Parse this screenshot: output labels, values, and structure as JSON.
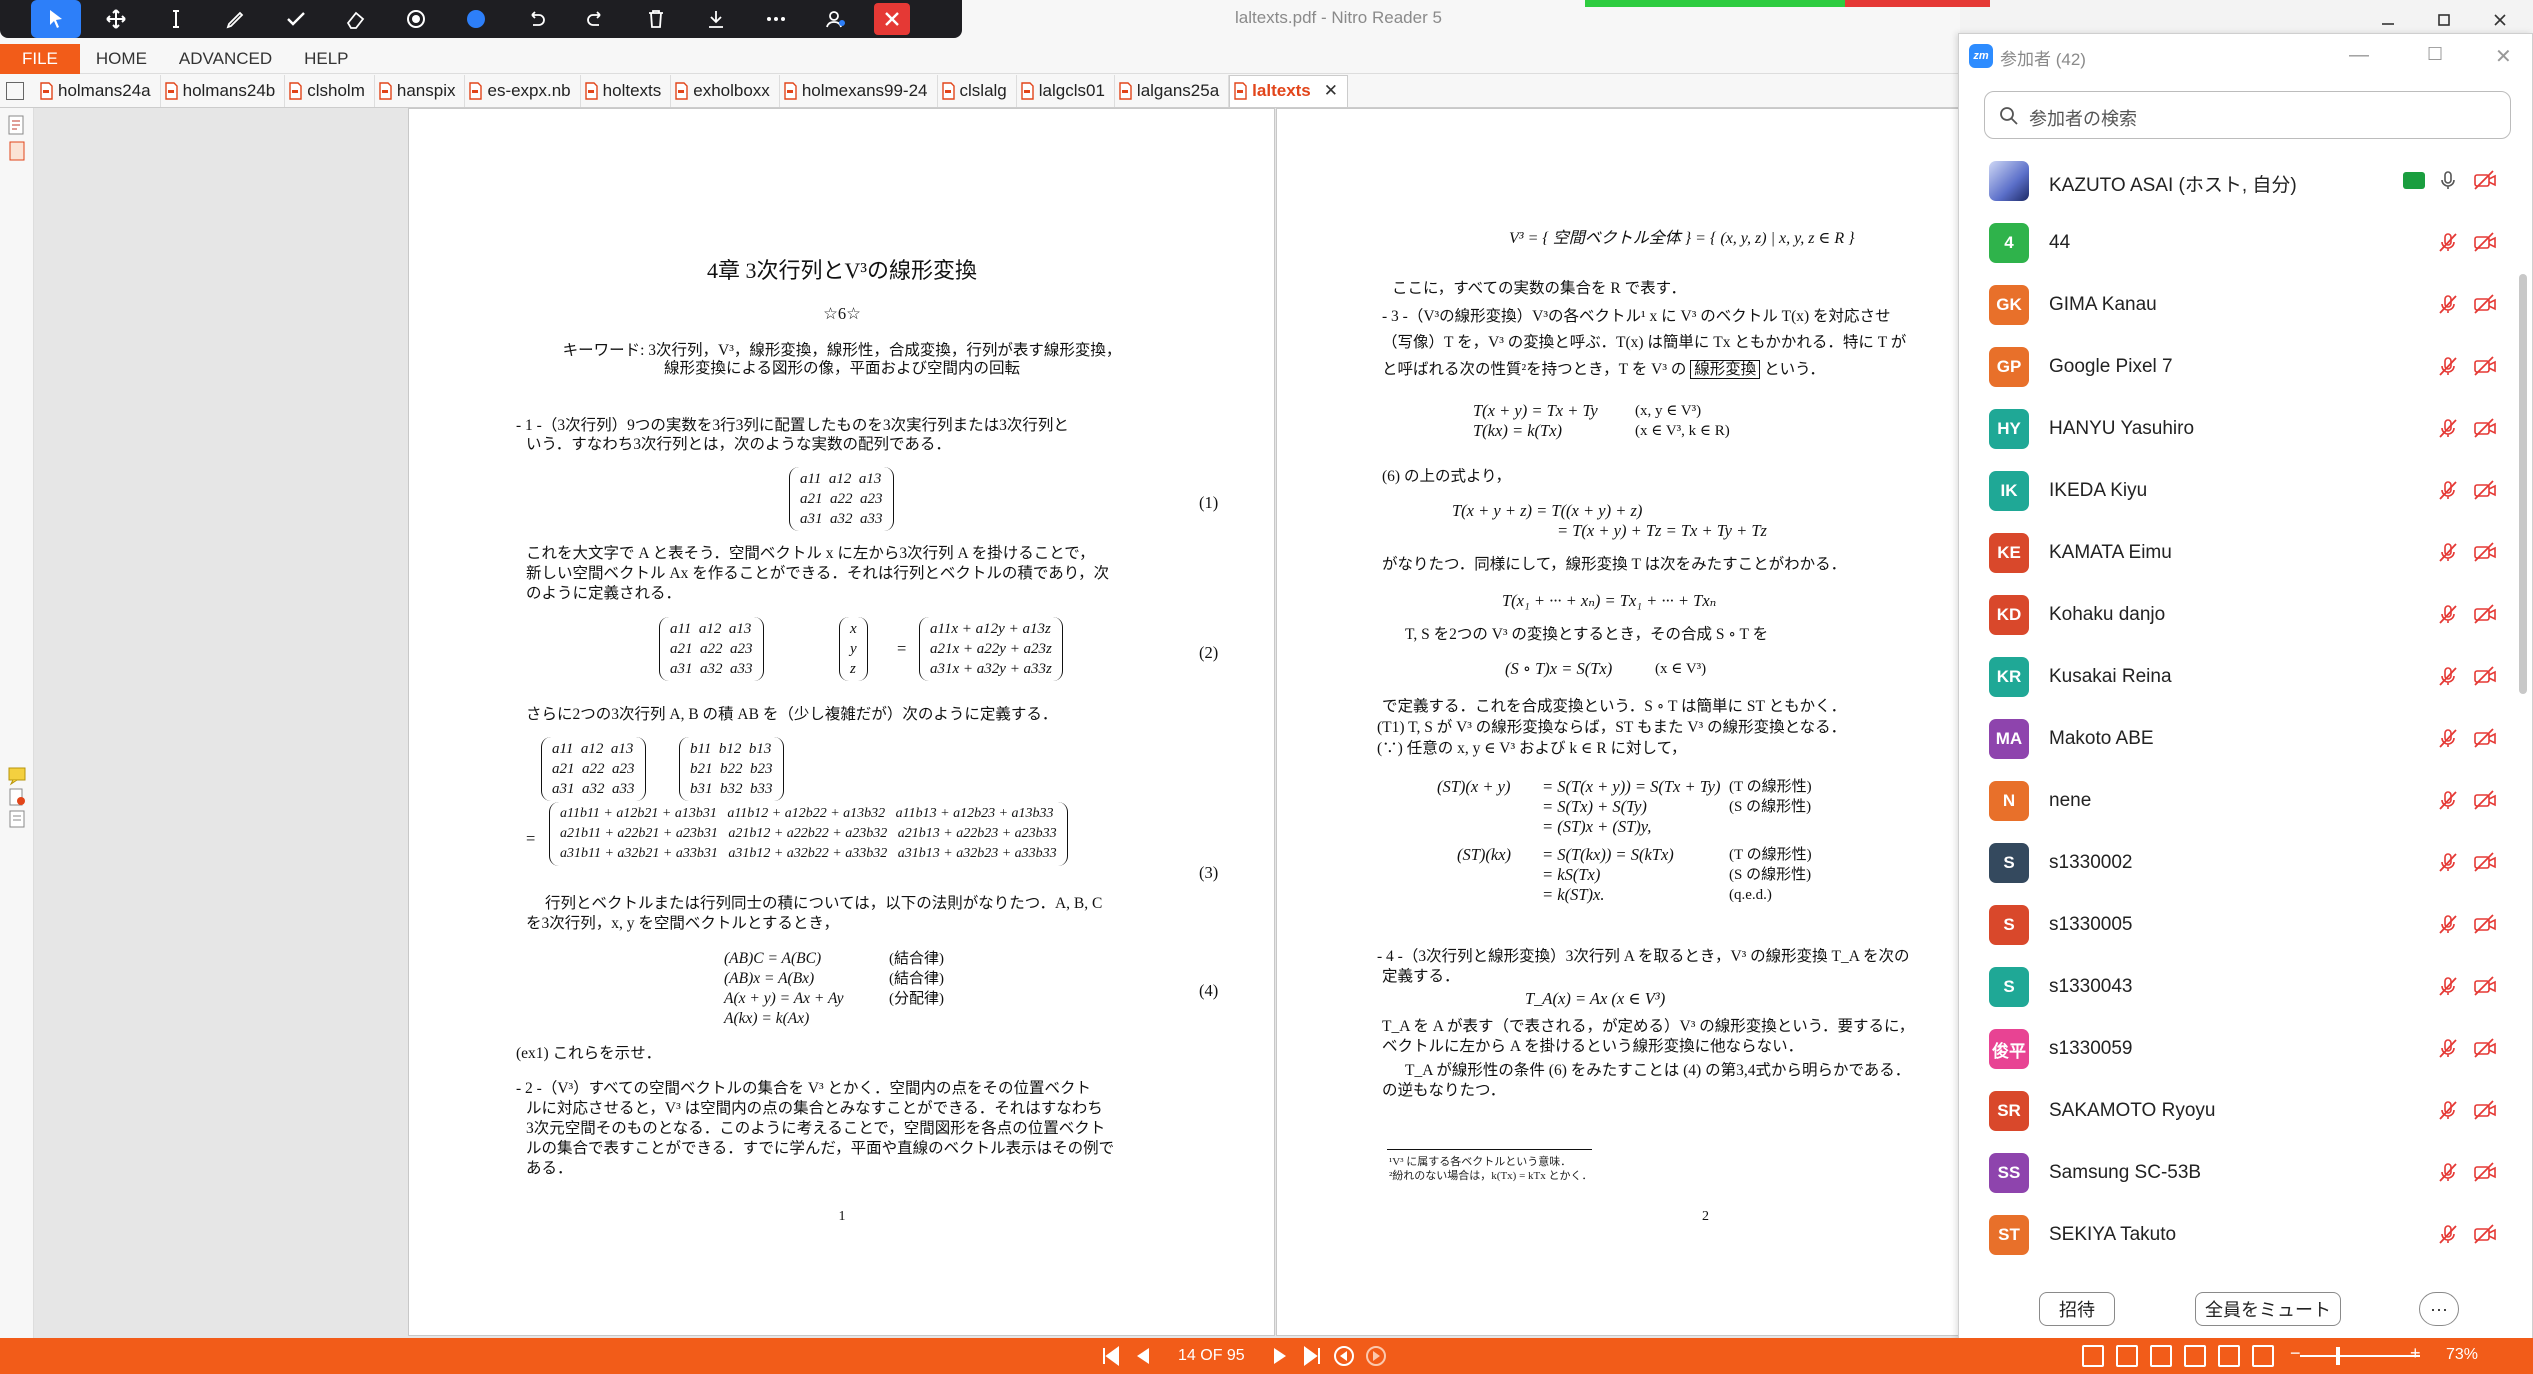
{
  "window": {
    "title": "laltexts.pdf - Nitro Reader 5"
  },
  "ribbon": {
    "tabs": [
      "FILE",
      "HOME",
      "ADVANCED",
      "HELP"
    ]
  },
  "doc_tabs": [
    {
      "label": "holmans24a",
      "active": false
    },
    {
      "label": "holmans24b",
      "active": false
    },
    {
      "label": "clsholm",
      "active": false
    },
    {
      "label": "hanspix",
      "active": false
    },
    {
      "label": "es-expx.nb",
      "active": false
    },
    {
      "label": "holtexts",
      "active": false
    },
    {
      "label": "exholboxx",
      "active": false
    },
    {
      "label": "holmexans99-24",
      "active": false
    },
    {
      "label": "clslalg",
      "active": false
    },
    {
      "label": "lalgcls01",
      "active": false
    },
    {
      "label": "lalgans25a",
      "active": false
    },
    {
      "label": "laltexts",
      "active": true
    }
  ],
  "page1": {
    "title": "4章 3次行列とV³の線形変換",
    "stars": "☆6☆",
    "keywords_1": "キーワード: 3次行列，V³，線形変換，線形性，合成変換，行列が表す線形変換，",
    "keywords_2": "線形変換による図形の像，平面および空間内の回転",
    "s1_a": "- 1 -（3次行列）9つの実数を3行3列に配置したものを3次実行列または3次行列と",
    "s1_b": "いう．すなわち3次行列とは，次のような実数の配列である．",
    "matA": "a11  a12  a13\na21  a22  a23\na31  a32  a33",
    "eq1": "(1)",
    "p2_a": "これを大文字で A と表そう．空間ベクトル x に左から3次行列 A を掛けることで，",
    "p2_b": "新しい空間ベクトル Ax を作ることができる．それは行列とベクトルの積であり，次",
    "p2_c": "のように定義される．",
    "matB": "a11  a12  a13\na21  a22  a23\na31  a32  a33",
    "vecx": "x\ny\nz",
    "eqsign": "=",
    "matC": "a11x + a12y + a13z\na21x + a22y + a23z\na31x + a32y + a33z",
    "eq2": "(2)",
    "p3": "さらに2つの3次行列 A, B の積 AB を（少し複雑だが）次のように定義する．",
    "matD": "a11  a12  a13\na21  a22  a23\na31  a32  a33",
    "matE": "b11  b12  b13\nb21  b22  b23\nb31  b32  b33",
    "matF": "a11b11 + a12b21 + a13b31   a11b12 + a12b22 + a13b32   a11b13 + a12b23 + a13b33\na21b11 + a22b21 + a23b31   a21b12 + a22b22 + a23b32   a21b13 + a22b23 + a23b33\na31b11 + a32b21 + a33b31   a31b12 + a32b22 + a33b32   a31b13 + a32b23 + a33b33",
    "eq3": "(3)",
    "p4_a": "行列とベクトルまたは行列同士の積については，以下の法則がなりたつ．A, B, C",
    "p4_b": "を3次行列，x, y を空間ベクトルとするとき，",
    "laws": [
      "(AB)C = A(BC)",
      "(AB)x = A(Bx)",
      "A(x + y) = Ax + Ay",
      "A(kx) = k(Ax)"
    ],
    "law_names": [
      "(結合律)",
      "(結合律)",
      "(分配律)"
    ],
    "eq4": "(4)",
    "ex1": "(ex1) これらを示せ．",
    "s2_a": "- 2 -（V³）すべての空間ベクトルの集合を V³ とかく．空間内の点をその位置ベクト",
    "s2_b": "ルに対応させると，V³ は空間内の点の集合とみなすことができる．それはすなわち",
    "s2_c": "3次元空間そのものとなる．このように考えることで，空間図形を各点の位置ベクト",
    "s2_d": "ルの集合で表すことができる．すでに学んだ，平面や直線のベクトル表示はその例で",
    "s2_e": "ある．",
    "pageno": "1"
  },
  "page2": {
    "v3def": "V³ = { 空間ベクトル全体 } = { (x, y, z) | x, y, z ∈ R }",
    "l1": "ここに，すべての実数の集合を R で表す．",
    "s3_a": "- 3 -（V³の線形変換）V³の各ベクトル¹ x に V³ のベクトル T(x) を対応させ",
    "s3_b": "（写像）T を，V³ の変換と呼ぶ．T(x) は簡単に Tx ともかかれる．特に T が",
    "s3_c": "と呼ばれる次の性質²を持つとき，T を V³ の",
    "boxed": "線形変換",
    "s3_d": "という．",
    "lin1": "T(x + y) = Tx + Ty",
    "lin1c": "(x, y ∈ V³)",
    "lin2": "T(kx) = k(Tx)",
    "lin2c": "(x ∈ V³, k ∈ R)",
    "l6": "(6) の上の式より，",
    "t1": "T(x + y + z) =  T((x + y) + z)",
    "t2": "=  T(x + y) + Tz = Tx + Ty + Tz",
    "l7": "がなりたつ．同様にして，線形変換 T は次をみたすことがわかる．",
    "t3": "T(x₁ + ··· + xₙ) = Tx₁ + ··· + Txₙ",
    "l8": "T, S を2つの V³ の変換とするとき，その合成 S ∘ T を",
    "t4": "(S ∘ T)x = S(Tx)",
    "t4c": "(x ∈ V³)",
    "l9": "で定義する．これを合成変換という．S ∘ T は簡単に ST ともかく．",
    "l10": "(T1) T, S が V³ の線形変換ならば，ST もまた V³ の線形変換となる．",
    "l11": "(∵) 任意の x, y ∈ V³ および k ∈ R に対して，",
    "pr1": "(ST)(x + y)",
    "pr1r": "= S(T(x + y)) = S(Tx + Ty)\n= S(Tx) + S(Ty)\n= (ST)x + (ST)y,",
    "pr1c": "(T の線形性)\n(S の線形性)",
    "pr2": "(ST)(kx)",
    "pr2r": "= S(T(kx)) = S(kTx)\n= kS(Tx)\n= k(ST)x.",
    "pr2c": "(T の線形性)\n(S の線形性)\n(q.e.d.)",
    "s4_a": "- 4 -（3次行列と線形変換）3次行列 A を取るとき，V³ の線形変換 T_A を次の",
    "s4_b": "定義する．",
    "t5": "T_A(x) = Ax   (x ∈ V³)",
    "l12": "T_A を A が表す（で表される，が定める）V³ の線形変換という．要するに，",
    "l13": "ベクトルに左から A を掛けるという線形変換に他ならない．",
    "l14": "T_A が線形性の条件 (6) をみたすことは (4) の第3,4式から明らかである．",
    "l15": "の逆もなりたつ．",
    "fn1": "¹V³ に属する各ベクトルという意味．",
    "fn2": "²紛れのない場合は，k(Tx) = kTx とかく．",
    "pageno": "2"
  },
  "status": {
    "page_indicator": "14 OF 95",
    "zoom": "73%"
  },
  "zoom_panel": {
    "title": "参加者 (42)",
    "logo": "zm",
    "search_placeholder": "参加者の検索",
    "participants": [
      {
        "initials": "",
        "name": "KAZUTO ASAI (ホスト, 自分)",
        "color": "#6b7fd7",
        "photo": true,
        "sharing": true,
        "muted": false
      },
      {
        "initials": "4",
        "name": "44",
        "color": "#2fb34b",
        "muted": true
      },
      {
        "initials": "GK",
        "name": "GIMA Kanau",
        "color": "#e8702a",
        "muted": true
      },
      {
        "initials": "GP",
        "name": "Google Pixel 7",
        "color": "#e8702a",
        "muted": true
      },
      {
        "initials": "HY",
        "name": "HANYU Yasuhiro",
        "color": "#1fa896",
        "muted": true
      },
      {
        "initials": "IK",
        "name": "IKEDA Kiyu",
        "color": "#1fa896",
        "muted": true
      },
      {
        "initials": "KE",
        "name": "KAMATA Eimu",
        "color": "#d9482b",
        "muted": true
      },
      {
        "initials": "KD",
        "name": "Kohaku danjo",
        "color": "#d9482b",
        "muted": true
      },
      {
        "initials": "KR",
        "name": "Kusakai Reina",
        "color": "#1fa896",
        "muted": true
      },
      {
        "initials": "MA",
        "name": "Makoto ABE",
        "color": "#8e44ad",
        "muted": true
      },
      {
        "initials": "N",
        "name": "nene",
        "color": "#e8702a",
        "muted": true
      },
      {
        "initials": "S",
        "name": "s1330002",
        "color": "#34495e",
        "muted": true
      },
      {
        "initials": "S",
        "name": "s1330005",
        "color": "#d9482b",
        "muted": true
      },
      {
        "initials": "S",
        "name": "s1330043",
        "color": "#1fa896",
        "muted": true
      },
      {
        "initials": "俊平",
        "name": "s1330059",
        "color": "#e84393",
        "muted": true
      },
      {
        "initials": "SR",
        "name": "SAKAMOTO Ryoyu",
        "color": "#d9482b",
        "muted": true
      },
      {
        "initials": "SS",
        "name": "Samsung SC-53B",
        "color": "#8e44ad",
        "muted": true
      },
      {
        "initials": "ST",
        "name": "SEKIYA Takuto",
        "color": "#e8702a",
        "muted": true
      }
    ],
    "invite_label": "招待",
    "mute_all_label": "全員をミュート",
    "more_label": "···"
  },
  "colors": {
    "accent": "#f25c19",
    "zoom_blue": "#2d8cff",
    "muted_red": "#e53935"
  },
  "icons": [
    "select-icon",
    "move-icon",
    "text-cursor-icon",
    "pen-icon",
    "check-icon",
    "eraser-icon",
    "stamp-icon",
    "color-icon",
    "undo-icon",
    "redo-icon",
    "trash-icon",
    "download-icon",
    "more-icon",
    "participants-icon",
    "close-icon"
  ]
}
